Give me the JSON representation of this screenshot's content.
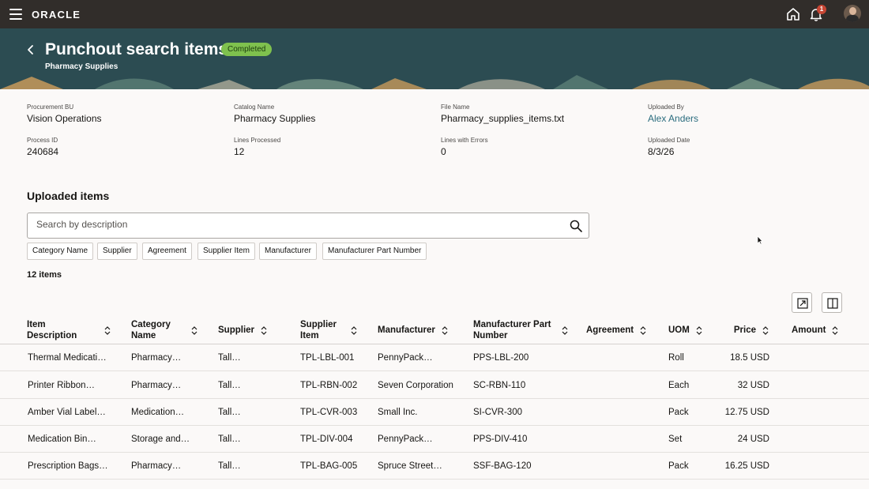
{
  "topbar": {
    "logo": "ORACLE",
    "notifications_count": "1"
  },
  "header": {
    "title": "Punchout search items",
    "status": "Completed",
    "subtitle": "Pharmacy Supplies"
  },
  "details": [
    {
      "label": "Procurement BU",
      "value": "Vision Operations"
    },
    {
      "label": "Catalog Name",
      "value": "Pharmacy Supplies"
    },
    {
      "label": "File Name",
      "value": "Pharmacy_supplies_items.txt"
    },
    {
      "label": "Uploaded By",
      "value": "Alex Anders"
    },
    {
      "label": "Process ID",
      "value": "240684"
    },
    {
      "label": "Lines Processed",
      "value": "12"
    },
    {
      "label": "Lines with Errors",
      "value": "0"
    },
    {
      "label": "Uploaded Date",
      "value": "8/3/26"
    }
  ],
  "uploaded": {
    "title": "Uploaded items",
    "search_placeholder": "Search by description",
    "filters": [
      "Category Name",
      "Supplier",
      "Agreement",
      "Supplier Item",
      "Manufacturer",
      "Manufacturer Part Number"
    ],
    "count": "12 items"
  },
  "table": {
    "columns": [
      "Item Description",
      "Category Name",
      "Supplier",
      "Supplier Item",
      "Manufacturer",
      "Manufacturer Part Number",
      "Agreement",
      "UOM",
      "Price",
      "Amount"
    ],
    "rows": [
      {
        "description": "Thermal Medicati…",
        "category": "Pharmacy…",
        "supplier": "Tall…",
        "supplier_item": "TPL-LBL-001",
        "manufacturer": "PennyPack…",
        "mpn": "PPS-LBL-200",
        "agreement": "",
        "uom": "Roll",
        "price": "18.5 USD",
        "amount": ""
      },
      {
        "description": "Printer Ribbon…",
        "category": "Pharmacy…",
        "supplier": "Tall…",
        "supplier_item": "TPL-RBN-002",
        "manufacturer": "Seven Corporation",
        "mpn": "SC-RBN-110",
        "agreement": "",
        "uom": "Each",
        "price": "32 USD",
        "amount": ""
      },
      {
        "description": "Amber Vial Label…",
        "category": "Medication…",
        "supplier": "Tall…",
        "supplier_item": "TPL-CVR-003",
        "manufacturer": "Small Inc.",
        "mpn": "SI-CVR-300",
        "agreement": "",
        "uom": "Pack",
        "price": "12.75 USD",
        "amount": ""
      },
      {
        "description": "Medication Bin…",
        "category": "Storage and…",
        "supplier": "Tall…",
        "supplier_item": "TPL-DIV-004",
        "manufacturer": "PennyPack…",
        "mpn": "PPS-DIV-410",
        "agreement": "",
        "uom": "Set",
        "price": "24 USD",
        "amount": ""
      },
      {
        "description": "Prescription Bags…",
        "category": "Pharmacy…",
        "supplier": "Tall…",
        "supplier_item": "TPL-BAG-005",
        "manufacturer": "Spruce Street…",
        "mpn": "SSF-BAG-120",
        "agreement": "",
        "uom": "Pack",
        "price": "16.25 USD",
        "amount": ""
      }
    ]
  },
  "colors": {
    "topbar": "#312d2a",
    "banner": "#2c4c52",
    "status_badge": "#7fc14e",
    "link": "#2a6c7e",
    "notification_badge": "#c74634"
  },
  "icons": [
    "menu-icon",
    "home-icon",
    "bell-icon",
    "back-icon",
    "search-icon",
    "export-icon",
    "columns-icon",
    "sort-icon"
  ]
}
